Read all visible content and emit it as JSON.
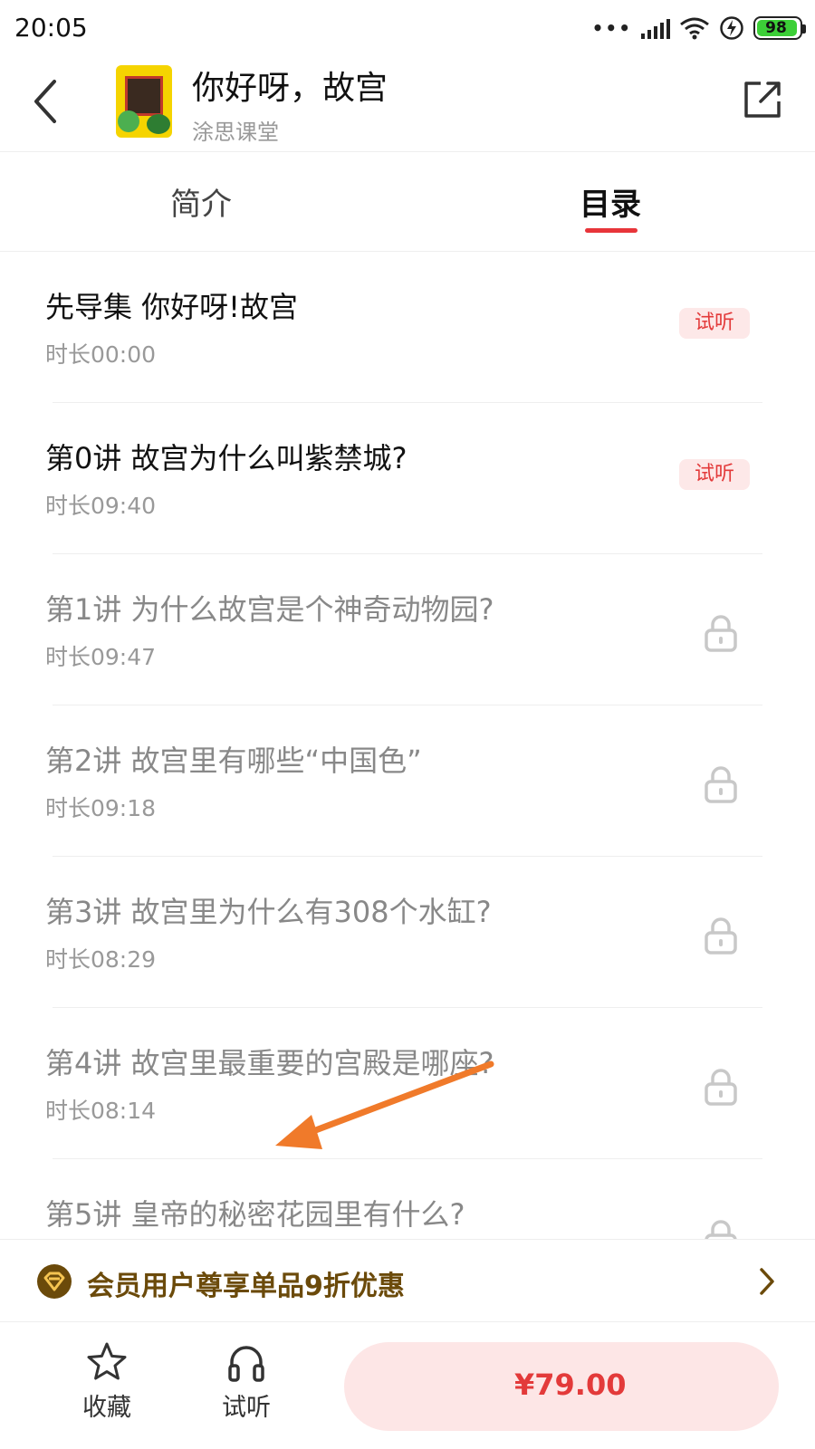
{
  "status_bar": {
    "time": "20:05",
    "dots": "•••",
    "battery": "98"
  },
  "header": {
    "title": "你好呀，故宫",
    "subtitle": "涂思课堂"
  },
  "tabs": [
    {
      "label": "简介"
    },
    {
      "label": "目录"
    }
  ],
  "active_tab": "目录",
  "episodes": [
    {
      "title": "先导集 你好呀!故宫",
      "duration": "时长00:00",
      "badge": "试听",
      "locked": false
    },
    {
      "title": "第0讲 故宫为什么叫紫禁城?",
      "duration": "时长09:40",
      "badge": "试听",
      "locked": false
    },
    {
      "title": "第1讲 为什么故宫是个神奇动物园?",
      "duration": "时长09:47",
      "locked": true
    },
    {
      "title": "第2讲 故宫里有哪些“中国色”",
      "duration": "时长09:18",
      "locked": true
    },
    {
      "title": "第3讲 故宫里为什么有308个水缸?",
      "duration": "时长08:29",
      "locked": true
    },
    {
      "title": "第4讲 故宫里最重要的宫殿是哪座?",
      "duration": "时长08:14",
      "locked": true
    },
    {
      "title": "第5讲 皇帝的秘密花园里有什么?",
      "duration": "",
      "locked": true
    }
  ],
  "member_bar": {
    "text": "会员用户尊享单品9折优惠"
  },
  "bottom_bar": {
    "collect_label": "收藏",
    "listen_label": "试听",
    "price": "¥79.00"
  },
  "colors": {
    "accent": "#e33a3a",
    "badge_bg": "#fde8e8",
    "member_gold": "#6b4a0a",
    "annotation": "#f07a2a"
  },
  "icons": [
    "back-arrow-icon",
    "share-icon",
    "lock-icon",
    "crown-icon",
    "chevron-right-icon",
    "star-icon",
    "headphones-icon"
  ]
}
